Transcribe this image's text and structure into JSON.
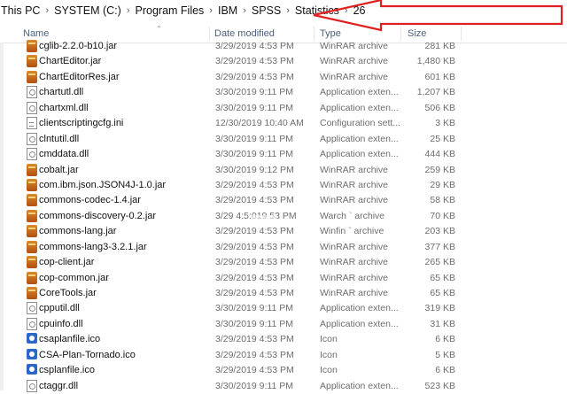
{
  "breadcrumb": {
    "items": [
      "This PC",
      "SYSTEM (C:)",
      "Program Files",
      "IBM",
      "SPSS",
      "Statistics",
      "26"
    ]
  },
  "annotation": {
    "arrow_color": "#e02020"
  },
  "columns": {
    "name": "Name",
    "date": "Date modified",
    "type": "Type",
    "size": "Size"
  },
  "files": [
    {
      "name": "cglib-2.2.0-b10.jar",
      "date": "3/29/2019 4:53 PM",
      "type": "WinRAR archive",
      "size": "281 KB",
      "icon": "jar-icon"
    },
    {
      "name": "ChartEditor.jar",
      "date": "3/29/2019 4:53 PM",
      "type": "WinRAR archive",
      "size": "1,480 KB",
      "icon": "jar-icon"
    },
    {
      "name": "ChartEditorRes.jar",
      "date": "3/29/2019 4:53 PM",
      "type": "WinRAR archive",
      "size": "601 KB",
      "icon": "jar-icon"
    },
    {
      "name": "chartutl.dll",
      "date": "3/30/2019 9:11 PM",
      "type": "Application exten...",
      "size": "1,207 KB",
      "icon": "dll-icon"
    },
    {
      "name": "chartxml.dll",
      "date": "3/30/2019 9:11 PM",
      "type": "Application exten...",
      "size": "506 KB",
      "icon": "dll-icon"
    },
    {
      "name": "clientscriptingcfg.ini",
      "date": "12/30/2019 10:40 AM",
      "type": "Configuration sett...",
      "size": "3 KB",
      "icon": "ini-icon"
    },
    {
      "name": "clntutil.dll",
      "date": "3/30/2019 9:11 PM",
      "type": "Application exten...",
      "size": "25 KB",
      "icon": "dll-icon"
    },
    {
      "name": "cmddata.dll",
      "date": "3/30/2019 9:11 PM",
      "type": "Application exten...",
      "size": "444 KB",
      "icon": "dll-icon"
    },
    {
      "name": "cobalt.jar",
      "date": "3/30/2019 9:12 PM",
      "type": "WinRAR archive",
      "size": "259 KB",
      "icon": "jar-icon"
    },
    {
      "name": "com.ibm.json.JSON4J-1.0.jar",
      "date": "3/29/2019 4:53 PM",
      "type": "WinRAR archive",
      "size": "29 KB",
      "icon": "jar-icon"
    },
    {
      "name": "commons-codec-1.4.jar",
      "date": "3/29/2019 4:53 PM",
      "type": "WinRAR archive",
      "size": "58 KB",
      "icon": "jar-icon"
    },
    {
      "name": "commons-discovery-0.2.jar",
      "date": "3/29 4:5:019 53 PM",
      "type": "Warch ` archive",
      "size": "70 KB",
      "icon": "jar-icon"
    },
    {
      "name": "commons-lang.jar",
      "date": "3/29/2019 4:53 PM",
      "type": "Winfin ` archive",
      "size": "203 KB",
      "icon": "jar-icon"
    },
    {
      "name": "commons-lang3-3.2.1.jar",
      "date": "3/29/2019 4:53 PM",
      "type": "WinRAR archive",
      "size": "377 KB",
      "icon": "jar-icon"
    },
    {
      "name": "cop-client.jar",
      "date": "3/29/2019 4:53 PM",
      "type": "WinRAR archive",
      "size": "265 KB",
      "icon": "jar-icon"
    },
    {
      "name": "cop-common.jar",
      "date": "3/29/2019 4:53 PM",
      "type": "WinRAR archive",
      "size": "65 KB",
      "icon": "jar-icon"
    },
    {
      "name": "CoreTools.jar",
      "date": "3/29/2019 4:53 PM",
      "type": "WinRAR archive",
      "size": "65 KB",
      "icon": "jar-icon"
    },
    {
      "name": "cpputil.dll",
      "date": "3/30/2019 9:11 PM",
      "type": "Application exten...",
      "size": "319 KB",
      "icon": "dll-icon"
    },
    {
      "name": "cpuinfo.dll",
      "date": "3/30/2019 9:11 PM",
      "type": "Application exten...",
      "size": "31 KB",
      "icon": "dll-icon"
    },
    {
      "name": "csaplanfile.ico",
      "date": "3/29/2019 4:53 PM",
      "type": "Icon",
      "size": "6 KB",
      "icon": "ico-icon"
    },
    {
      "name": "CSA-Plan-Tornado.ico",
      "date": "3/29/2019 4:53 PM",
      "type": "Icon",
      "size": "5 KB",
      "icon": "ico-icon"
    },
    {
      "name": "csplanfile.ico",
      "date": "3/29/2019 4:53 PM",
      "type": "Icon",
      "size": "6 KB",
      "icon": "ico-icon"
    },
    {
      "name": "ctaggr.dll",
      "date": "3/30/2019 9:11 PM",
      "type": "Application exten...",
      "size": "523 KB",
      "icon": "dll-icon"
    }
  ]
}
